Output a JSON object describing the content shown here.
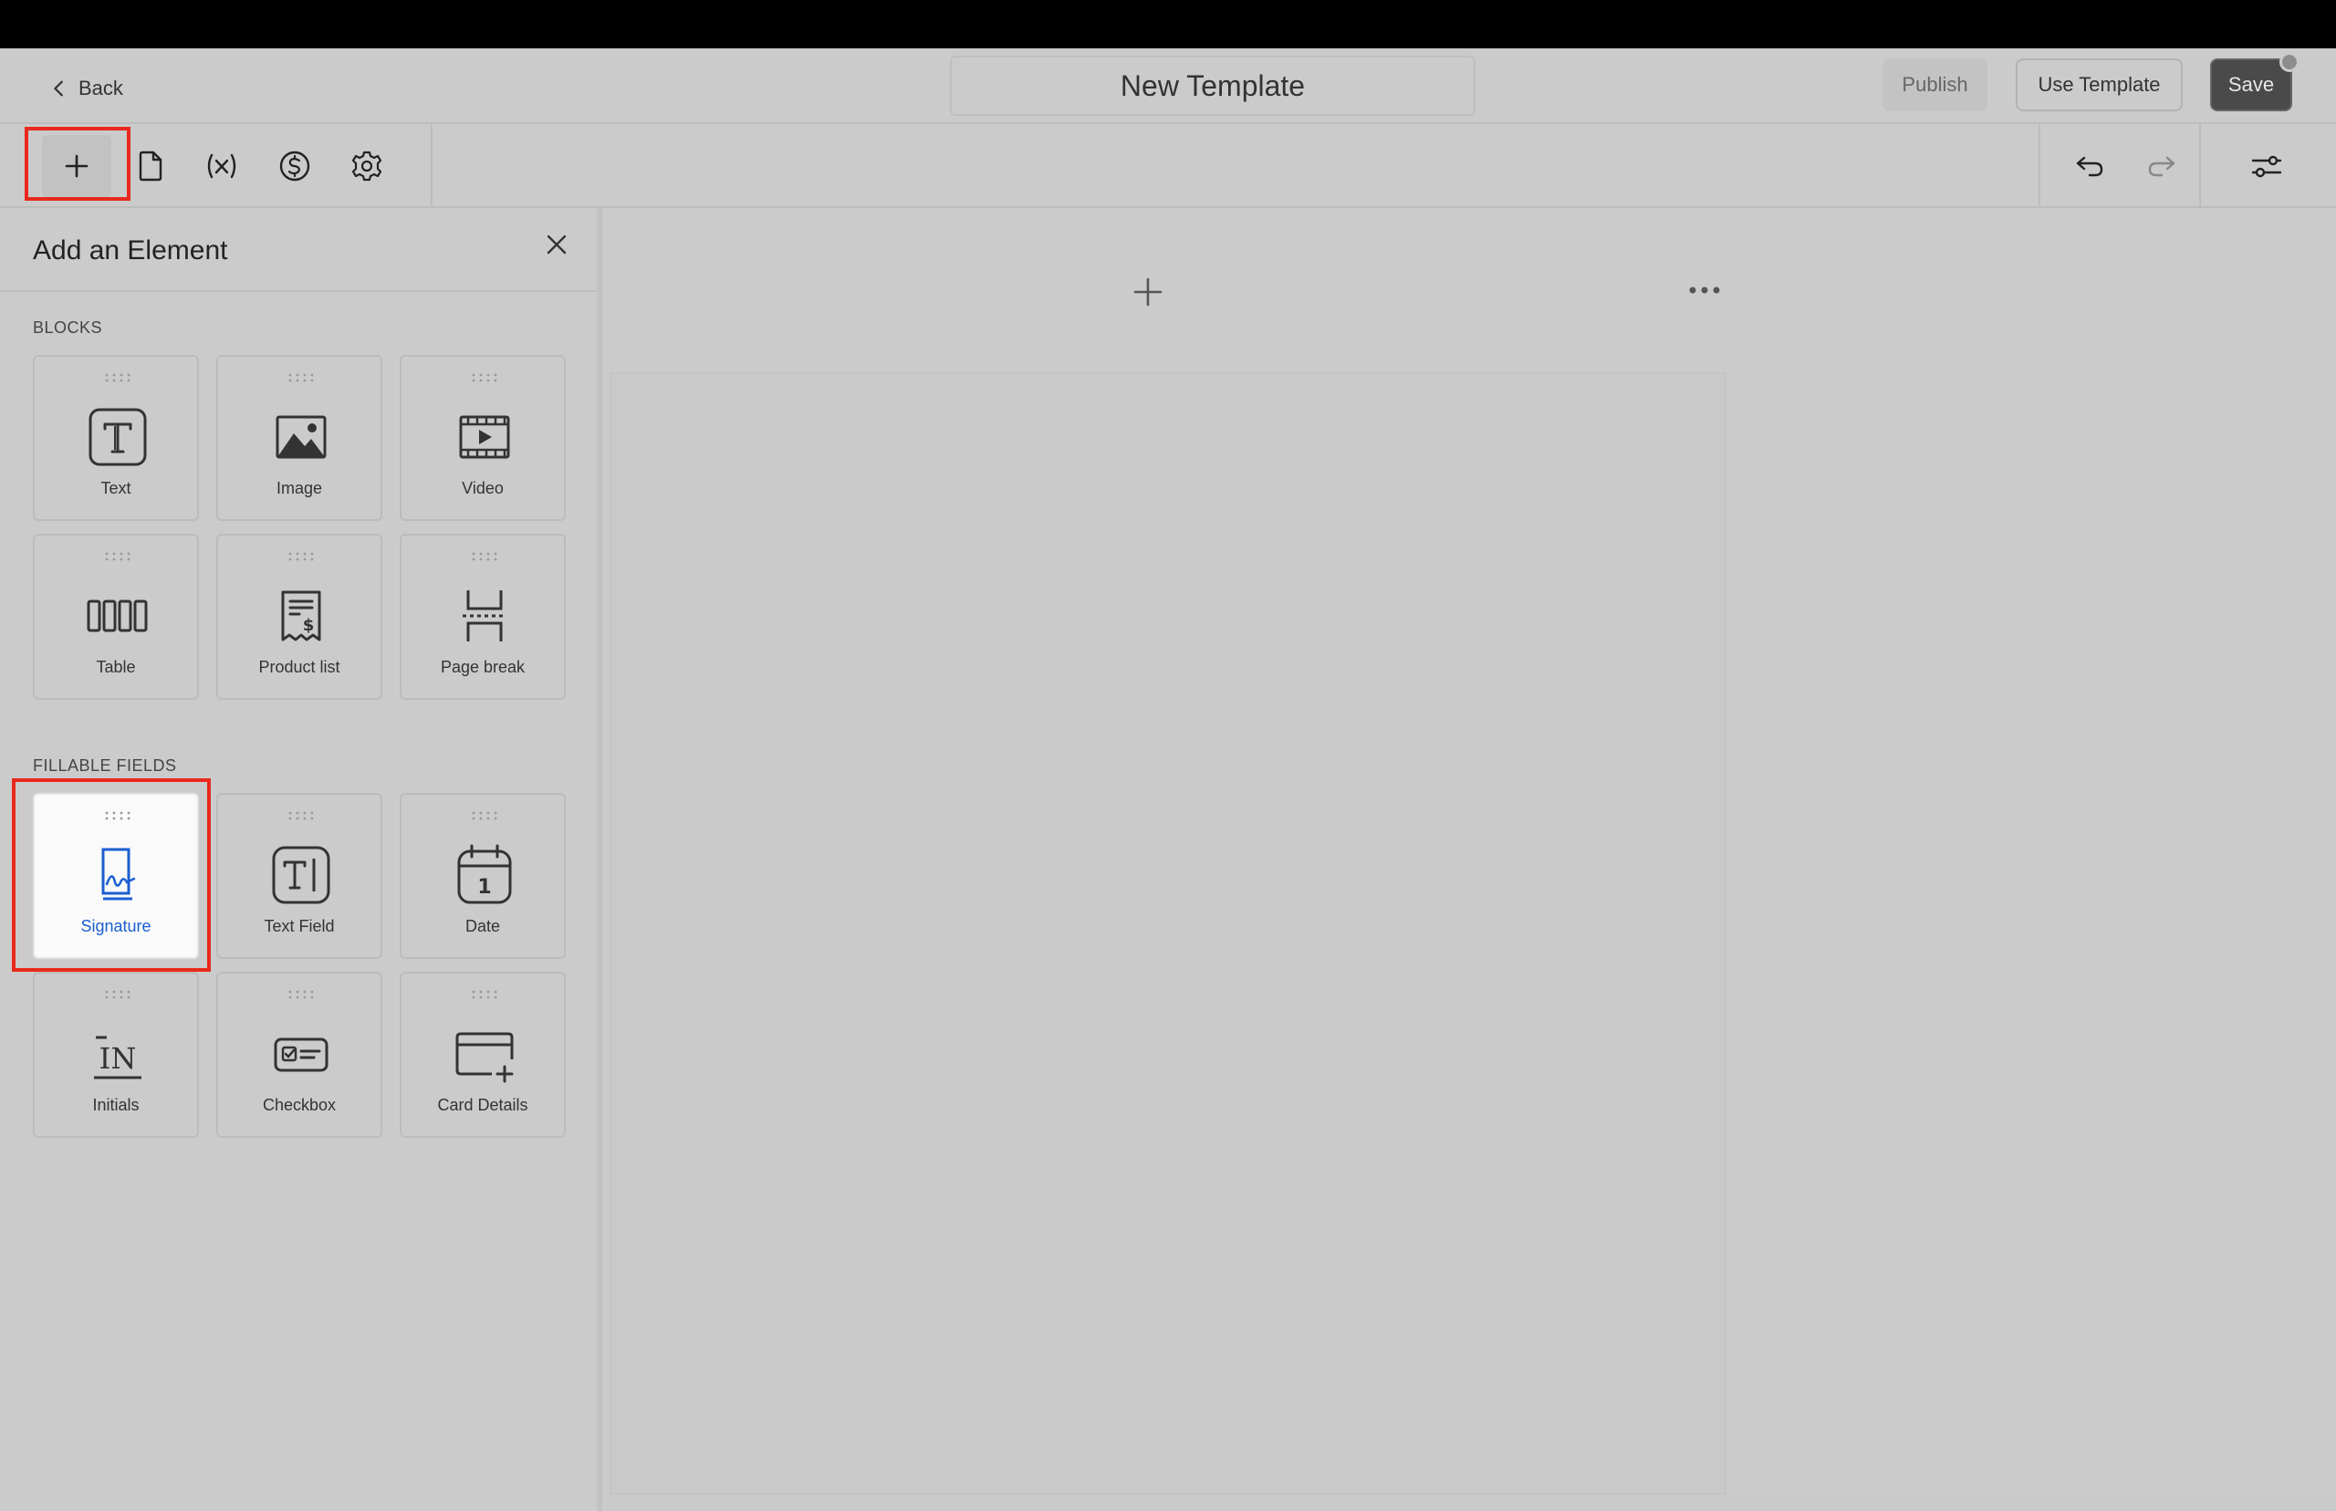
{
  "header": {
    "back_label": "Back",
    "title": "New Template",
    "publish_label": "Publish",
    "use_template_label": "Use Template",
    "save_label": "Save"
  },
  "toolbar": {
    "left_icons": [
      "plus-icon",
      "document-icon",
      "variable-icon",
      "dollar-icon",
      "gear-icon"
    ],
    "right_icons": [
      "undo-icon",
      "redo-icon",
      "settings-sliders-icon"
    ]
  },
  "sidebar": {
    "title": "Add an Element",
    "blocks_label": "BLOCKS",
    "fillable_label": "FILLABLE FIELDS",
    "blocks": [
      {
        "label": "Text",
        "icon": "text-icon"
      },
      {
        "label": "Image",
        "icon": "image-icon"
      },
      {
        "label": "Video",
        "icon": "video-icon"
      },
      {
        "label": "Table",
        "icon": "table-icon"
      },
      {
        "label": "Product list",
        "icon": "product-list-icon"
      },
      {
        "label": "Page break",
        "icon": "page-break-icon"
      }
    ],
    "fields": [
      {
        "label": "Signature",
        "icon": "signature-icon"
      },
      {
        "label": "Text Field",
        "icon": "text-field-icon"
      },
      {
        "label": "Date",
        "icon": "date-icon",
        "day": "1"
      },
      {
        "label": "Initials",
        "icon": "initials-icon",
        "glyph": "IN"
      },
      {
        "label": "Checkbox",
        "icon": "checkbox-icon"
      },
      {
        "label": "Card Details",
        "icon": "card-details-icon"
      }
    ]
  },
  "colors": {
    "background": "#cbcbcb",
    "highlight": "#e8291c",
    "active_label": "#1b5fd1",
    "save_button": "#4a4a4a"
  }
}
